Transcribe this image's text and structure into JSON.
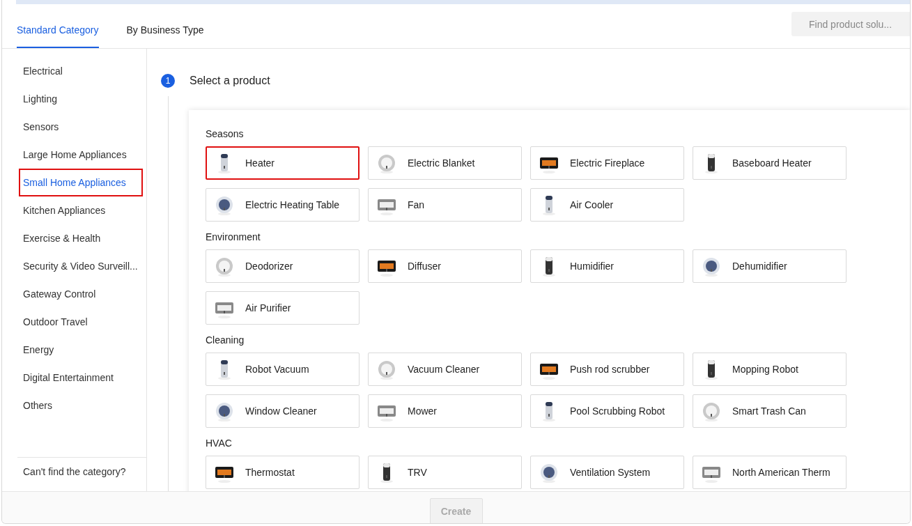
{
  "tabs": [
    {
      "label": "Standard Category",
      "selected": true
    },
    {
      "label": "By Business Type",
      "selected": false
    }
  ],
  "search": {
    "placeholder": "Find product solu..."
  },
  "sidebar": {
    "items": [
      {
        "label": "Electrical",
        "selected": false
      },
      {
        "label": "Lighting",
        "selected": false
      },
      {
        "label": "Sensors",
        "selected": false
      },
      {
        "label": "Large Home Appliances",
        "selected": false
      },
      {
        "label": "Small Home Appliances",
        "selected": true
      },
      {
        "label": "Kitchen Appliances",
        "selected": false
      },
      {
        "label": "Exercise & Health",
        "selected": false
      },
      {
        "label": "Security & Video Surveill...",
        "selected": false
      },
      {
        "label": "Gateway Control",
        "selected": false
      },
      {
        "label": "Outdoor Travel",
        "selected": false
      },
      {
        "label": "Energy",
        "selected": false
      },
      {
        "label": "Digital Entertainment",
        "selected": false
      },
      {
        "label": "Others",
        "selected": false
      }
    ],
    "footer_link": "Can't find the category?"
  },
  "step": {
    "number": "1",
    "title": "Select a product"
  },
  "sections": [
    {
      "title": "Seasons",
      "products": [
        {
          "name": "Heater",
          "selected": true
        },
        {
          "name": "Electric Blanket",
          "selected": false
        },
        {
          "name": "Electric Fireplace",
          "selected": false
        },
        {
          "name": "Baseboard Heater",
          "selected": false
        },
        {
          "name": "Electric Heating Table",
          "selected": false
        },
        {
          "name": "Fan",
          "selected": false
        },
        {
          "name": "Air Cooler",
          "selected": false
        }
      ]
    },
    {
      "title": "Environment",
      "products": [
        {
          "name": "Deodorizer",
          "selected": false
        },
        {
          "name": "Diffuser",
          "selected": false
        },
        {
          "name": "Humidifier",
          "selected": false
        },
        {
          "name": "Dehumidifier",
          "selected": false
        },
        {
          "name": "Air Purifier",
          "selected": false
        }
      ]
    },
    {
      "title": "Cleaning",
      "products": [
        {
          "name": "Robot Vacuum",
          "selected": false
        },
        {
          "name": "Vacuum Cleaner",
          "selected": false
        },
        {
          "name": "Push rod scrubber",
          "selected": false
        },
        {
          "name": "Mopping Robot",
          "selected": false
        },
        {
          "name": "Window Cleaner",
          "selected": false
        },
        {
          "name": "Mower",
          "selected": false
        },
        {
          "name": "Pool Scrubbing Robot",
          "selected": false
        },
        {
          "name": "Smart Trash Can",
          "selected": false
        }
      ]
    },
    {
      "title": "HVAC",
      "products": [
        {
          "name": "Thermostat",
          "selected": false
        },
        {
          "name": "TRV",
          "selected": false
        },
        {
          "name": "Ventilation System",
          "selected": false
        },
        {
          "name": "North American Therm",
          "selected": false
        }
      ]
    }
  ],
  "create_button": {
    "label": "Create",
    "disabled": true
  }
}
